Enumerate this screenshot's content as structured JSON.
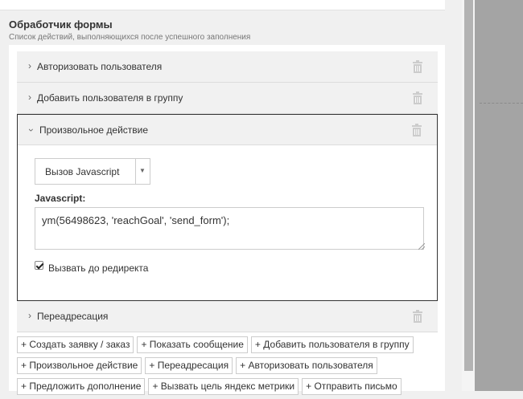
{
  "section": {
    "title": "Обработчик формы",
    "subtitle": "Список действий, выполняющихся после успешного заполнения"
  },
  "actions": [
    {
      "title": "Авторизовать пользователя",
      "expanded": false
    },
    {
      "title": "Добавить пользователя в группу",
      "expanded": false
    },
    {
      "title": "Произвольное действие",
      "expanded": true
    },
    {
      "title": "Переадресация",
      "expanded": false
    }
  ],
  "editor": {
    "select_value": "Вызов Javascript",
    "js_label": "Javascript:",
    "code": "ym(56498623, 'reachGoal', 'send_form');",
    "checkbox_label": "Вызвать до редиректа",
    "checkbox_checked": true
  },
  "add_buttons": {
    "row1": [
      "+ Создать заявку / заказ",
      "+ Показать сообщение",
      "+ Добавить пользователя в группу"
    ],
    "row2": [
      "+ Произвольное действие",
      "+ Переадресация",
      "+ Авторизовать пользователя"
    ],
    "row3": [
      "+ Предложить дополнение",
      "+ Вызвать цель яндекс метрики",
      "+ Отправить письмо"
    ]
  },
  "icons": {
    "chevron_right": "chevron-right-icon",
    "chevron_down": "chevron-down-icon",
    "trash": "trash-icon"
  }
}
